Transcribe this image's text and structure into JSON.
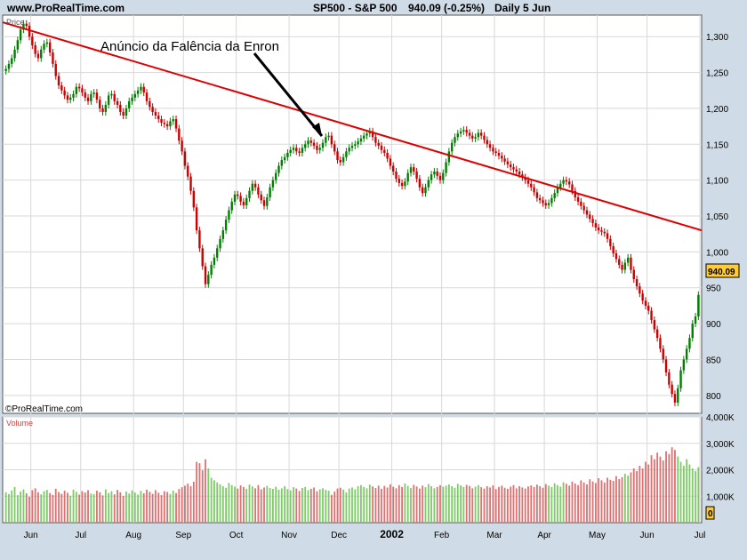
{
  "header": {
    "site": "www.ProRealTime.com",
    "instrument": "SP500 - S&P 500",
    "quote": "940.09 (-0.25%)",
    "period": "Daily  5 Jun"
  },
  "watermark": "©ProRealTime.com",
  "chart_data": [
    {
      "type": "candlestick",
      "title": "",
      "panel_label": "Price",
      "ylim": [
        775,
        1330
      ],
      "y_ticks": [
        "1,300",
        "1,250",
        "1,200",
        "1,150",
        "1,100",
        "1,050",
        "1,000",
        "950",
        "900",
        "850",
        "800"
      ],
      "last_price": "940.09",
      "months": [
        "Jun",
        "Jul",
        "Aug",
        "Sep",
        "Oct",
        "Nov",
        "Dec",
        "2002",
        "Feb",
        "Mar",
        "Apr",
        "May",
        "Jun",
        "Jul"
      ],
      "closes": [
        1255,
        1262,
        1270,
        1282,
        1295,
        1310,
        1318,
        1315,
        1300,
        1288,
        1276,
        1270,
        1282,
        1290,
        1292,
        1278,
        1262,
        1245,
        1232,
        1225,
        1218,
        1212,
        1215,
        1220,
        1230,
        1228,
        1222,
        1215,
        1210,
        1220,
        1222,
        1212,
        1200,
        1195,
        1205,
        1218,
        1220,
        1210,
        1205,
        1195,
        1190,
        1200,
        1210,
        1215,
        1220,
        1225,
        1230,
        1222,
        1210,
        1202,
        1195,
        1190,
        1185,
        1180,
        1178,
        1175,
        1182,
        1185,
        1172,
        1155,
        1140,
        1120,
        1105,
        1085,
        1062,
        1030,
        1005,
        980,
        955,
        968,
        982,
        992,
        1005,
        1018,
        1030,
        1045,
        1058,
        1070,
        1080,
        1078,
        1070,
        1065,
        1075,
        1085,
        1095,
        1090,
        1080,
        1072,
        1064,
        1076,
        1090,
        1100,
        1110,
        1120,
        1128,
        1132,
        1138,
        1142,
        1145,
        1140,
        1138,
        1145,
        1150,
        1155,
        1152,
        1148,
        1142,
        1145,
        1152,
        1160,
        1162,
        1150,
        1140,
        1128,
        1125,
        1132,
        1140,
        1145,
        1148,
        1150,
        1154,
        1158,
        1162,
        1165,
        1168,
        1160,
        1152,
        1148,
        1142,
        1138,
        1130,
        1120,
        1112,
        1102,
        1096,
        1092,
        1098,
        1110,
        1118,
        1112,
        1102,
        1090,
        1082,
        1090,
        1100,
        1108,
        1112,
        1106,
        1100,
        1110,
        1125,
        1140,
        1152,
        1160,
        1165,
        1168,
        1170,
        1166,
        1162,
        1158,
        1160,
        1166,
        1162,
        1156,
        1150,
        1145,
        1140,
        1138,
        1134,
        1130,
        1126,
        1122,
        1118,
        1115,
        1112,
        1108,
        1104,
        1100,
        1095,
        1090,
        1083,
        1075,
        1072,
        1068,
        1065,
        1068,
        1075,
        1082,
        1090,
        1095,
        1100,
        1098,
        1094,
        1085,
        1076,
        1070,
        1064,
        1058,
        1052,
        1046,
        1040,
        1034,
        1030,
        1028,
        1026,
        1018,
        1008,
        998,
        990,
        982,
        975,
        985,
        992,
        975,
        962,
        952,
        942,
        932,
        925,
        918,
        905,
        892,
        880,
        865,
        850,
        832,
        815,
        802,
        790,
        810,
        835,
        850,
        865,
        880,
        900,
        910,
        940
      ]
    },
    {
      "type": "bar",
      "title": "",
      "panel_label": "Volume",
      "ylim": [
        0,
        4000000
      ],
      "y_ticks": [
        "4,000K",
        "3,000K",
        "2,000K",
        "1,000K"
      ],
      "last_value": "0",
      "values": [
        1150000,
        1080000,
        1220000,
        1350000,
        1040000,
        1180000,
        1260000,
        1110000,
        980000,
        1230000,
        1300000,
        1150000,
        1070000,
        1190000,
        1240000,
        1120000,
        1050000,
        1280000,
        1160000,
        1090000,
        1210000,
        1130000,
        1020000,
        1250000,
        1170000,
        1060000,
        1190000,
        1140000,
        1230000,
        1100000,
        1080000,
        1210000,
        1150000,
        1030000,
        1260000,
        1120000,
        1190000,
        1070000,
        1240000,
        1150000,
        1010000,
        1180000,
        1100000,
        1220000,
        1140000,
        1060000,
        1200000,
        1110000,
        1250000,
        1170000,
        1090000,
        1230000,
        1130000,
        1040000,
        1190000,
        1160000,
        1080000,
        1210000,
        1120000,
        1270000,
        1340000,
        1400000,
        1480000,
        1380000,
        1550000,
        2300000,
        2250000,
        1980000,
        2400000,
        2050000,
        1700000,
        1600000,
        1520000,
        1450000,
        1380000,
        1320000,
        1500000,
        1420000,
        1360000,
        1290000,
        1410000,
        1350000,
        1280000,
        1440000,
        1370000,
        1300000,
        1420000,
        1260000,
        1330000,
        1390000,
        1310000,
        1280000,
        1360000,
        1250000,
        1300000,
        1380000,
        1270000,
        1220000,
        1340000,
        1290000,
        1200000,
        1310000,
        1350000,
        1230000,
        1280000,
        1330000,
        1190000,
        1260000,
        1300000,
        1240000,
        1210000,
        1050000,
        1180000,
        1290000,
        1320000,
        1250000,
        1140000,
        1290000,
        1330000,
        1260000,
        1380000,
        1420000,
        1350000,
        1300000,
        1440000,
        1370000,
        1310000,
        1400000,
        1280000,
        1390000,
        1330000,
        1450000,
        1360000,
        1300000,
        1420000,
        1350000,
        1480000,
        1390000,
        1310000,
        1430000,
        1370000,
        1290000,
        1400000,
        1340000,
        1460000,
        1380000,
        1300000,
        1350000,
        1420000,
        1360000,
        1400000,
        1450000,
        1380000,
        1320000,
        1470000,
        1410000,
        1350000,
        1430000,
        1390000,
        1300000,
        1360000,
        1420000,
        1340000,
        1290000,
        1380000,
        1330000,
        1410000,
        1270000,
        1350000,
        1400000,
        1320000,
        1280000,
        1360000,
        1420000,
        1300000,
        1380000,
        1330000,
        1290000,
        1370000,
        1410000,
        1350000,
        1440000,
        1380000,
        1320000,
        1460000,
        1400000,
        1350000,
        1490000,
        1420000,
        1360000,
        1530000,
        1470000,
        1400000,
        1550000,
        1480000,
        1420000,
        1600000,
        1520000,
        1450000,
        1640000,
        1560000,
        1500000,
        1680000,
        1600000,
        1520000,
        1700000,
        1620000,
        1580000,
        1760000,
        1650000,
        1720000,
        1850000,
        1780000,
        1900000,
        2050000,
        1950000,
        2150000,
        2050000,
        2300000,
        2200000,
        2550000,
        2400000,
        2650000,
        2500000,
        2350000,
        2700000,
        2600000,
        2850000,
        2750000,
        2500000,
        2300000,
        2150000,
        2400000,
        2200000,
        2050000,
        1950000,
        2100000
      ]
    }
  ],
  "annotations": {
    "arrow_label": "Anúncio da Falência da Enron",
    "trendline": {
      "start_value": 1320,
      "end_value": 1030,
      "color": "#dd0000"
    }
  },
  "colors": {
    "background": "#cfdbe6",
    "panel": "#ffffff",
    "up": "#008000",
    "down": "#cc0000",
    "volume_up": "#7ccc66",
    "volume_down": "#e07070",
    "gridline": "#d8d8d8",
    "highlight_box": "#ffcc33"
  }
}
